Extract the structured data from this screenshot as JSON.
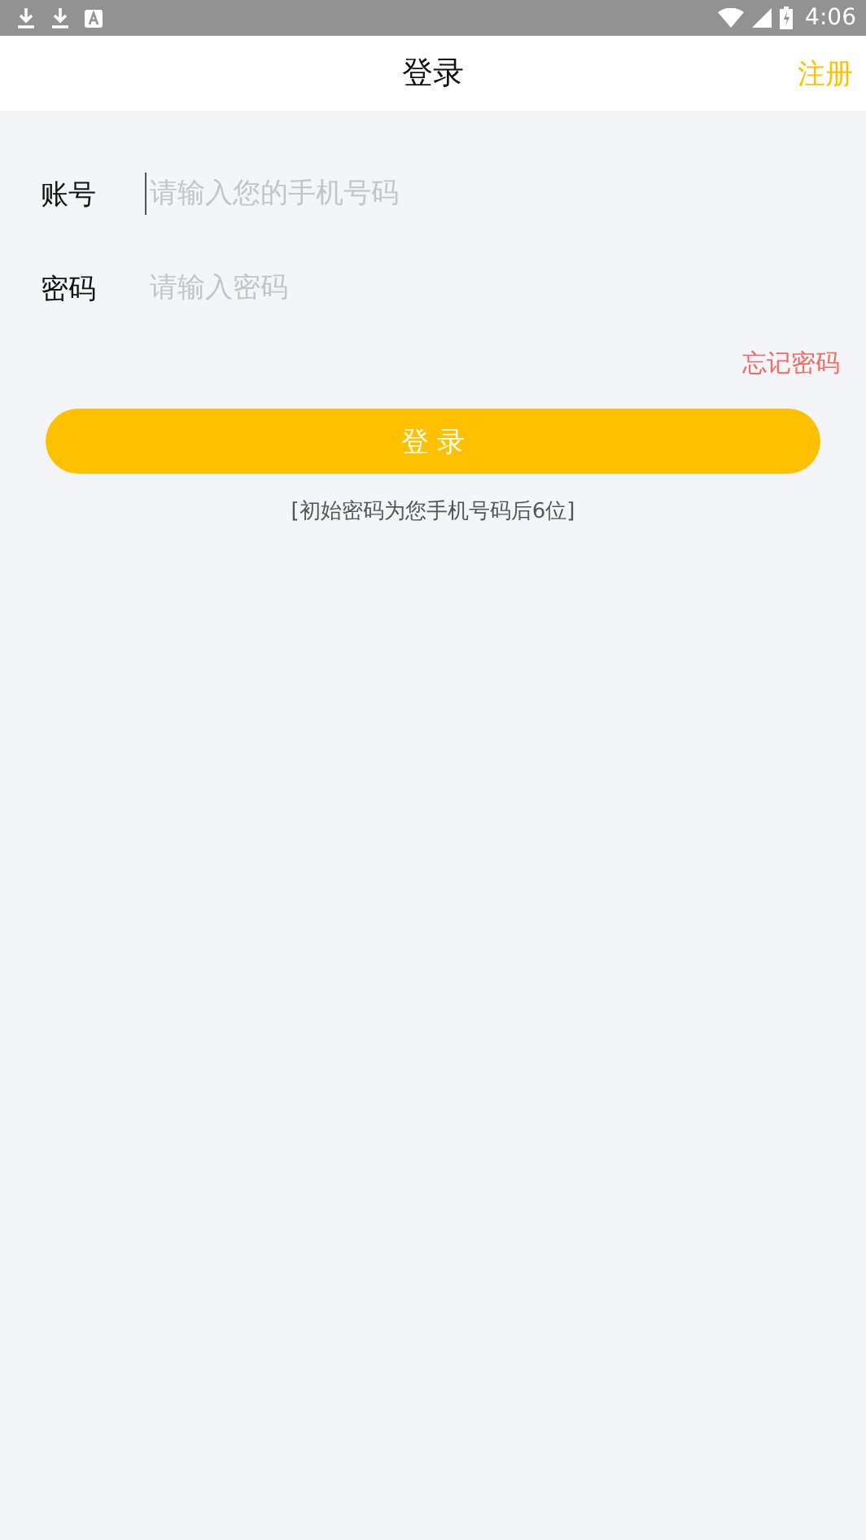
{
  "status_bar": {
    "time": "4:06"
  },
  "header": {
    "title": "登录",
    "action": "注册"
  },
  "fields": [
    {
      "label": "账号",
      "placeholder": "请输入您的手机号码",
      "focused": true
    },
    {
      "label": "密码",
      "placeholder": "请输入密码",
      "focused": false
    }
  ],
  "forgot_link": "忘记密码",
  "login_button": "登 录",
  "hint": "[初始密码为您手机号码后6位]"
}
